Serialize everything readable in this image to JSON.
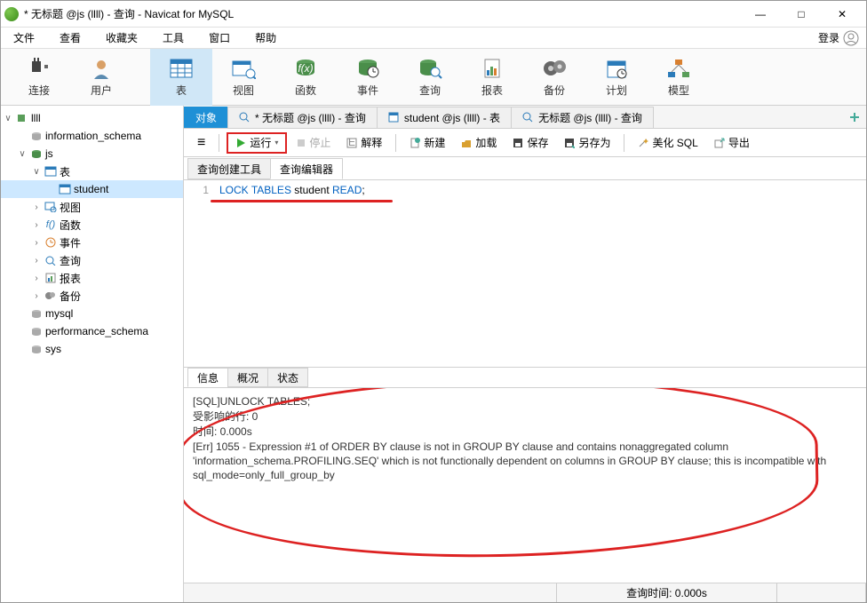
{
  "title": "* 无标题 @js (llll) - 查询 - Navicat for MySQL",
  "win": {
    "min": "—",
    "max": "□",
    "close": "✕"
  },
  "menu": {
    "file": "文件",
    "view": "查看",
    "fav": "收藏夹",
    "tools": "工具",
    "window": "窗口",
    "help": "帮助",
    "login": "登录"
  },
  "ribbon": {
    "conn": "连接",
    "user": "用户",
    "table": "表",
    "rview": "视图",
    "func": "函数",
    "event": "事件",
    "query": "查询",
    "report": "报表",
    "backup": "备份",
    "plan": "计划",
    "model": "模型"
  },
  "tree": {
    "root": "llll",
    "dbs": [
      "information_schema"
    ],
    "db_open": "js",
    "nodes": {
      "tables": "表",
      "views": "视图",
      "funcs": "函数",
      "events": "事件",
      "queries": "查询",
      "reports": "报表",
      "backups": "备份"
    },
    "tbl_open": "student",
    "other_dbs": [
      "mysql",
      "performance_schema",
      "sys"
    ]
  },
  "tabs": {
    "obj": "对象",
    "t2": "* 无标题 @js (llll) - 查询",
    "t3": "student @js (llll) - 表",
    "t4": "无标题 @js (llll) - 查询"
  },
  "toolbar": {
    "menu": "≡",
    "run": "运行",
    "stop": "停止",
    "explain": "解释",
    "new": "新建",
    "load": "加载",
    "save": "保存",
    "saveas": "另存为",
    "beautify": "美化 SQL",
    "export": "导出"
  },
  "subtabs": {
    "builder": "查询创建工具",
    "editor": "查询编辑器"
  },
  "sql": {
    "lineno": "1",
    "kw1": "LOCK",
    "kw2": "TABLES",
    "ident": "student",
    "kw3": "READ",
    "semi": ";"
  },
  "outtabs": {
    "info": "信息",
    "profile": "概况",
    "status": "状态"
  },
  "output": {
    "l1": "[SQL]UNLOCK TABLES;",
    "l2": "受影响的行: 0",
    "l3": "时间: 0.000s",
    "l4": "",
    "l5": "[Err] 1055 - Expression #1 of ORDER BY clause is not in GROUP BY clause and contains nonaggregated column 'information_schema.PROFILING.SEQ' which is not functionally dependent on columns in GROUP BY clause; this is incompatible with sql_mode=only_full_group_by"
  },
  "status": {
    "time": "查询时间: 0.000s"
  }
}
